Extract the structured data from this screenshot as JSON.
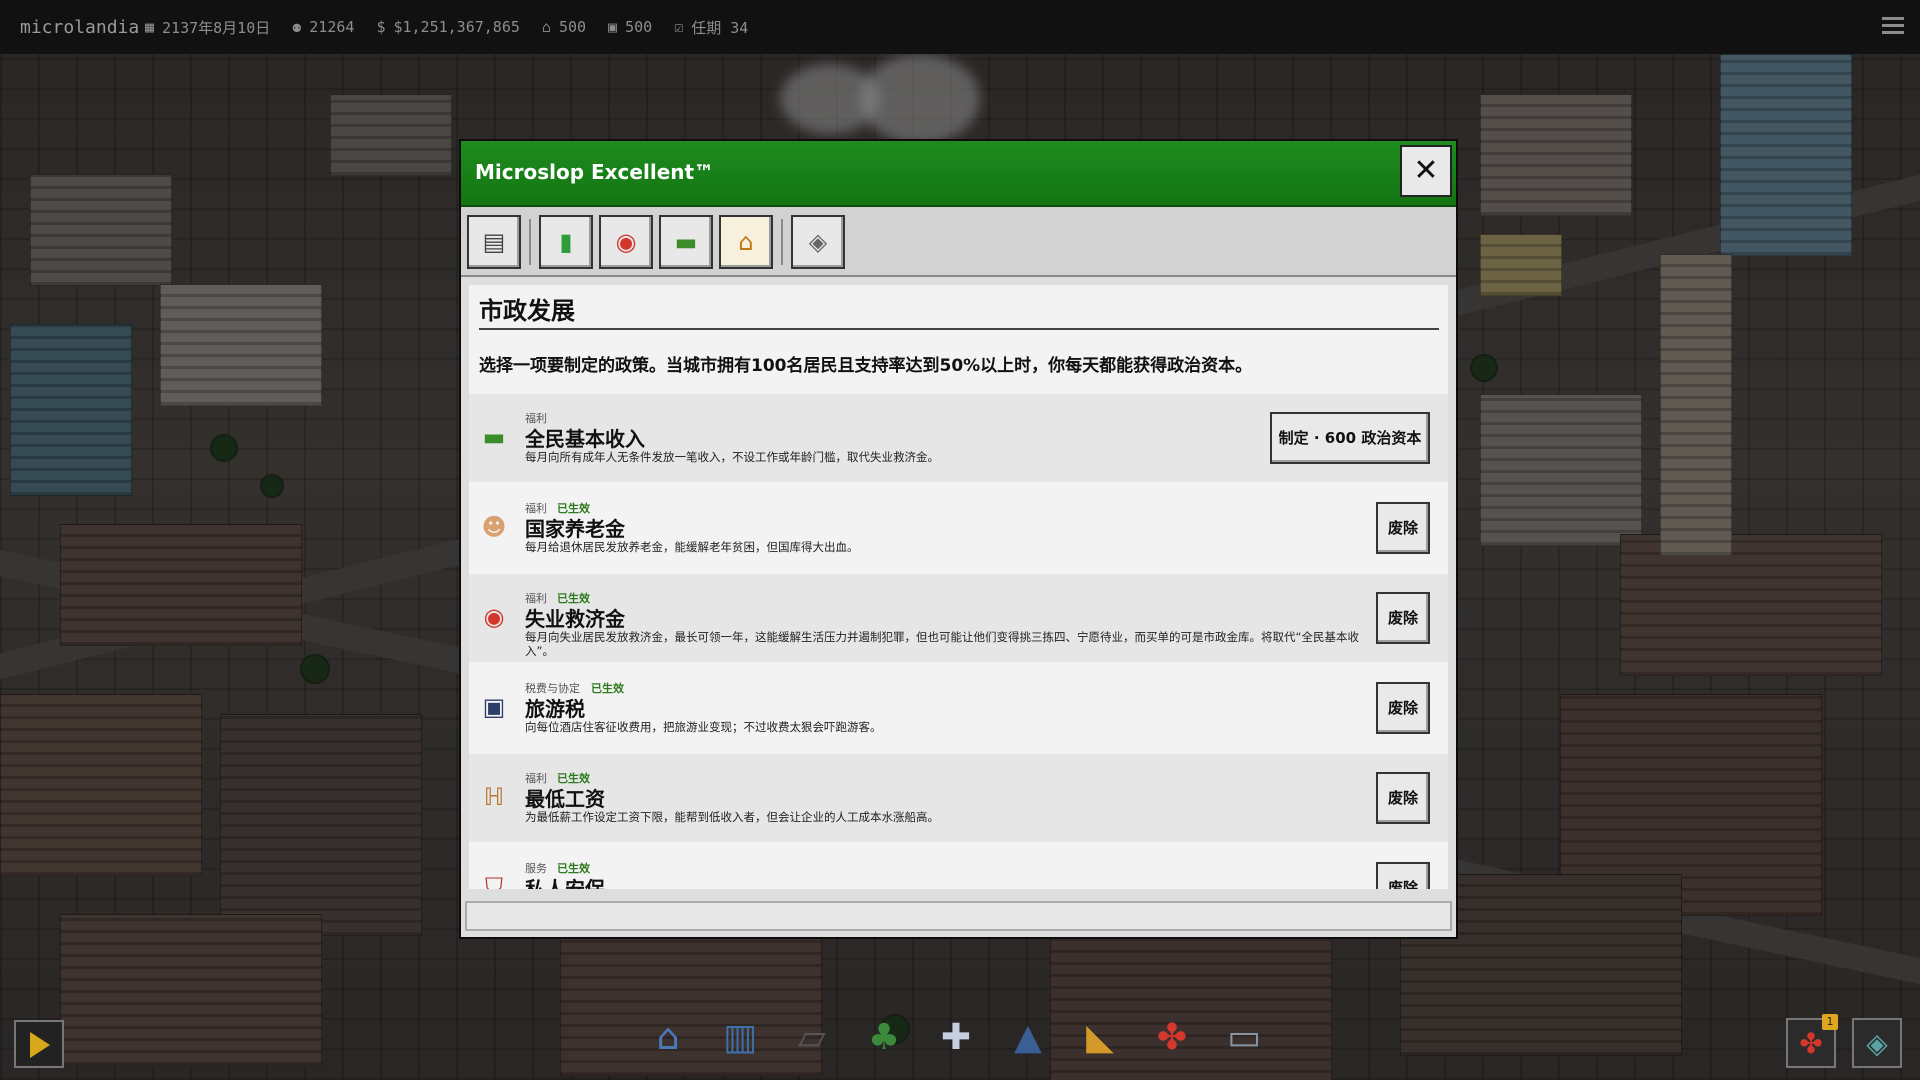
{
  "app": {
    "logo": "microlandia"
  },
  "topbar": {
    "date": "2137年8月10日",
    "population": "21264",
    "money": "$1,251,367,865",
    "housing": "500",
    "jobs": "500",
    "term": "任期 34"
  },
  "dialog": {
    "title": "Microslop Excellent™",
    "close_label": "✕",
    "toolbar": [
      {
        "icon": "save-icon"
      },
      {
        "icon": "chart-icon"
      },
      {
        "icon": "lifebuoy-icon"
      },
      {
        "icon": "money-icon"
      },
      {
        "icon": "bank-icon",
        "active": true
      },
      {
        "icon": "tax-icon"
      }
    ],
    "section_title": "市政发展",
    "section_desc": "选择一项要制定的政策。当城市拥有100名居民且支持率达到50%以上时，你每天都能获得政治资本。",
    "policies": [
      {
        "icon": "money-icon",
        "category": "福利",
        "status": "",
        "name": "全民基本收入",
        "desc": "每月向所有成年人无条件发放一笔收入，不设工作或年龄门槛，取代失业救济金。",
        "button": "制定 · 600 政治资本"
      },
      {
        "icon": "elder-face-icon",
        "category": "福利",
        "status": "已生效",
        "name": "国家养老金",
        "desc": "每月给退休居民发放养老金，能缓解老年贫困，但国库得大出血。",
        "button": "废除"
      },
      {
        "icon": "lifebuoy-icon",
        "category": "福利",
        "status": "已生效",
        "name": "失业救济金",
        "desc": "每月向失业居民发放救济金，最长可领一年，这能缓解生活压力并遏制犯罪，但也可能让他们变得挑三拣四、宁愿待业，而买单的可是市政金库。将取代“全民基本收入”。",
        "button": "废除"
      },
      {
        "icon": "suitcase-icon",
        "category": "税费与协定",
        "status": "已生效",
        "name": "旅游税",
        "desc": "向每位酒店住客征收费用，把旅游业变现；不过收费太狠会吓跑游客。",
        "button": "废除"
      },
      {
        "icon": "ladder-icon",
        "category": "福利",
        "status": "已生效",
        "name": "最低工资",
        "desc": "为最低薪工作设定工资下限，能帮到低收入者，但会让企业的人工成本水涨船高。",
        "button": "废除"
      },
      {
        "icon": "shield-icon",
        "category": "服务",
        "status": "已生效",
        "name": "私人安保",
        "desc": "",
        "button": "废除"
      }
    ]
  },
  "dock": [
    {
      "icon": "house-icon"
    },
    {
      "icon": "shop-icon"
    },
    {
      "icon": "road-icon"
    },
    {
      "icon": "tree-icon"
    },
    {
      "icon": "hospital-icon"
    },
    {
      "icon": "school-icon"
    },
    {
      "icon": "bulldozer-icon"
    },
    {
      "icon": "gift-icon"
    },
    {
      "icon": "computer-icon"
    }
  ],
  "corner": {
    "gift_badge": "1"
  }
}
